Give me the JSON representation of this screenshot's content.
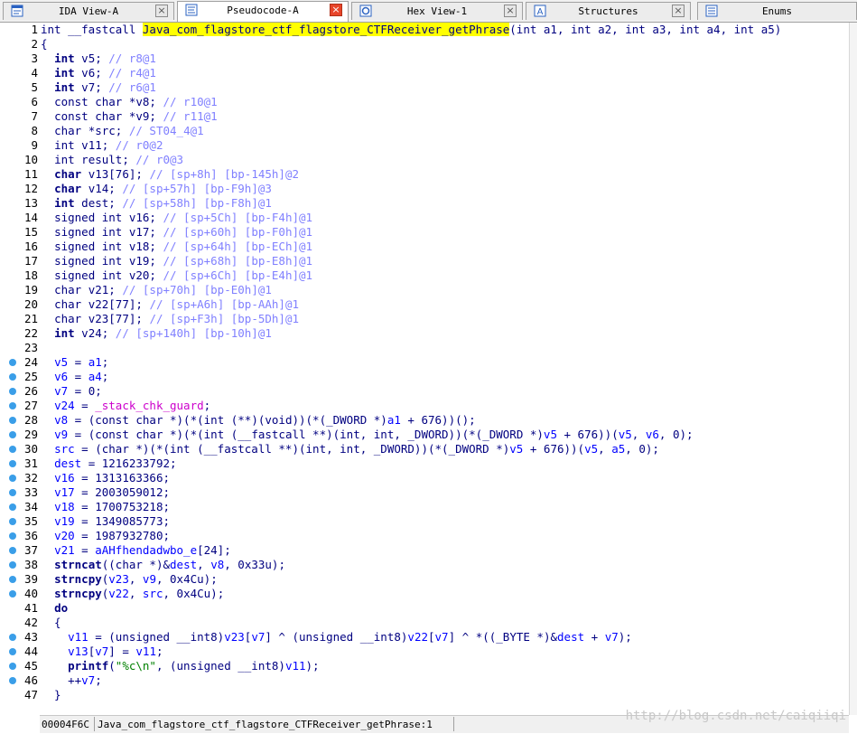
{
  "tabs": [
    {
      "label": "IDA View-A",
      "icon": "ida-view-icon",
      "active": false
    },
    {
      "label": "Pseudocode-A",
      "icon": "pseudocode-icon",
      "active": true
    },
    {
      "label": "Hex View-1",
      "icon": "hex-view-icon",
      "active": false
    },
    {
      "label": "Structures",
      "icon": "structures-icon",
      "active": false
    },
    {
      "label": "Enums",
      "icon": "enums-icon",
      "active": false
    }
  ],
  "lines": [
    {
      "n": "1",
      "bp": false,
      "parts": [
        [
          "type",
          "int __fastcall "
        ],
        [
          "hl",
          "Java_com_flagstore_ctf_flagstore_CTFReceiver_getPhrase"
        ],
        [
          "pl",
          "(int a1, int a2, int a3, int a4, int a5)"
        ]
      ]
    },
    {
      "n": "2",
      "bp": false,
      "parts": [
        [
          "pl",
          "{"
        ]
      ]
    },
    {
      "n": "3",
      "bp": false,
      "parts": [
        [
          "pl",
          "  "
        ],
        [
          "kw",
          "int"
        ],
        [
          "pl",
          " v5; "
        ],
        [
          "cmt",
          "// r8@1"
        ]
      ]
    },
    {
      "n": "4",
      "bp": false,
      "parts": [
        [
          "pl",
          "  "
        ],
        [
          "kw",
          "int"
        ],
        [
          "pl",
          " v6; "
        ],
        [
          "cmt",
          "// r4@1"
        ]
      ]
    },
    {
      "n": "5",
      "bp": false,
      "parts": [
        [
          "pl",
          "  "
        ],
        [
          "kw",
          "int"
        ],
        [
          "pl",
          " v7; "
        ],
        [
          "cmt",
          "// r6@1"
        ]
      ]
    },
    {
      "n": "6",
      "bp": false,
      "parts": [
        [
          "pl",
          "  "
        ],
        [
          "type",
          "const char"
        ],
        [
          "pl",
          " *v8; "
        ],
        [
          "cmt",
          "// r10@1"
        ]
      ]
    },
    {
      "n": "7",
      "bp": false,
      "parts": [
        [
          "pl",
          "  "
        ],
        [
          "type",
          "const char"
        ],
        [
          "pl",
          " *v9; "
        ],
        [
          "cmt",
          "// r11@1"
        ]
      ]
    },
    {
      "n": "8",
      "bp": false,
      "parts": [
        [
          "pl",
          "  "
        ],
        [
          "type",
          "char"
        ],
        [
          "pl",
          " *src; "
        ],
        [
          "cmt",
          "// ST04_4@1"
        ]
      ]
    },
    {
      "n": "9",
      "bp": false,
      "parts": [
        [
          "pl",
          "  "
        ],
        [
          "type",
          "int"
        ],
        [
          "pl",
          " v11; "
        ],
        [
          "cmt",
          "// r0@2"
        ]
      ]
    },
    {
      "n": "10",
      "bp": false,
      "parts": [
        [
          "pl",
          "  "
        ],
        [
          "type",
          "int"
        ],
        [
          "pl",
          " result; "
        ],
        [
          "cmt",
          "// r0@3"
        ]
      ]
    },
    {
      "n": "11",
      "bp": false,
      "parts": [
        [
          "pl",
          "  "
        ],
        [
          "kw",
          "char"
        ],
        [
          "pl",
          " v13[76]; "
        ],
        [
          "cmt",
          "// [sp+8h] [bp-145h]@2"
        ]
      ]
    },
    {
      "n": "12",
      "bp": false,
      "parts": [
        [
          "pl",
          "  "
        ],
        [
          "kw",
          "char"
        ],
        [
          "pl",
          " v14; "
        ],
        [
          "cmt",
          "// [sp+57h] [bp-F9h]@3"
        ]
      ]
    },
    {
      "n": "13",
      "bp": false,
      "parts": [
        [
          "pl",
          "  "
        ],
        [
          "kw",
          "int"
        ],
        [
          "pl",
          " dest; "
        ],
        [
          "cmt",
          "// [sp+58h] [bp-F8h]@1"
        ]
      ]
    },
    {
      "n": "14",
      "bp": false,
      "parts": [
        [
          "pl",
          "  "
        ],
        [
          "type",
          "signed int"
        ],
        [
          "pl",
          " v16; "
        ],
        [
          "cmt",
          "// [sp+5Ch] [bp-F4h]@1"
        ]
      ]
    },
    {
      "n": "15",
      "bp": false,
      "parts": [
        [
          "pl",
          "  "
        ],
        [
          "type",
          "signed int"
        ],
        [
          "pl",
          " v17; "
        ],
        [
          "cmt",
          "// [sp+60h] [bp-F0h]@1"
        ]
      ]
    },
    {
      "n": "16",
      "bp": false,
      "parts": [
        [
          "pl",
          "  "
        ],
        [
          "type",
          "signed int"
        ],
        [
          "pl",
          " v18; "
        ],
        [
          "cmt",
          "// [sp+64h] [bp-ECh]@1"
        ]
      ]
    },
    {
      "n": "17",
      "bp": false,
      "parts": [
        [
          "pl",
          "  "
        ],
        [
          "type",
          "signed int"
        ],
        [
          "pl",
          " v19; "
        ],
        [
          "cmt",
          "// [sp+68h] [bp-E8h]@1"
        ]
      ]
    },
    {
      "n": "18",
      "bp": false,
      "parts": [
        [
          "pl",
          "  "
        ],
        [
          "type",
          "signed int"
        ],
        [
          "pl",
          " v20; "
        ],
        [
          "cmt",
          "// [sp+6Ch] [bp-E4h]@1"
        ]
      ]
    },
    {
      "n": "19",
      "bp": false,
      "parts": [
        [
          "pl",
          "  "
        ],
        [
          "type",
          "char"
        ],
        [
          "pl",
          " v21; "
        ],
        [
          "cmt",
          "// [sp+70h] [bp-E0h]@1"
        ]
      ]
    },
    {
      "n": "20",
      "bp": false,
      "parts": [
        [
          "pl",
          "  "
        ],
        [
          "type",
          "char"
        ],
        [
          "pl",
          " v22[77]; "
        ],
        [
          "cmt",
          "// [sp+A6h] [bp-AAh]@1"
        ]
      ]
    },
    {
      "n": "21",
      "bp": false,
      "parts": [
        [
          "pl",
          "  "
        ],
        [
          "type",
          "char"
        ],
        [
          "pl",
          " v23[77]; "
        ],
        [
          "cmt",
          "// [sp+F3h] [bp-5Dh]@1"
        ]
      ]
    },
    {
      "n": "22",
      "bp": false,
      "parts": [
        [
          "pl",
          "  "
        ],
        [
          "kw",
          "int"
        ],
        [
          "pl",
          " v24; "
        ],
        [
          "cmt",
          "// [sp+140h] [bp-10h]@1"
        ]
      ]
    },
    {
      "n": "23",
      "bp": false,
      "parts": []
    },
    {
      "n": "24",
      "bp": true,
      "parts": [
        [
          "pl",
          "  "
        ],
        [
          "var",
          "v5"
        ],
        [
          "pl",
          " = "
        ],
        [
          "var",
          "a1"
        ],
        [
          "pl",
          ";"
        ]
      ]
    },
    {
      "n": "25",
      "bp": true,
      "parts": [
        [
          "pl",
          "  "
        ],
        [
          "var",
          "v6"
        ],
        [
          "pl",
          " = "
        ],
        [
          "var",
          "a4"
        ],
        [
          "pl",
          ";"
        ]
      ]
    },
    {
      "n": "26",
      "bp": true,
      "parts": [
        [
          "pl",
          "  "
        ],
        [
          "var",
          "v7"
        ],
        [
          "pl",
          " = 0;"
        ]
      ]
    },
    {
      "n": "27",
      "bp": true,
      "parts": [
        [
          "pl",
          "  "
        ],
        [
          "var",
          "v24"
        ],
        [
          "pl",
          " = "
        ],
        [
          "glob",
          "_stack_chk_guard"
        ],
        [
          "pl",
          ";"
        ]
      ]
    },
    {
      "n": "28",
      "bp": true,
      "parts": [
        [
          "pl",
          "  "
        ],
        [
          "var",
          "v8"
        ],
        [
          "pl",
          " = (const char *)(*(int (**)(void))(*(_DWORD *)"
        ],
        [
          "var",
          "a1"
        ],
        [
          "pl",
          " + 676))();"
        ]
      ]
    },
    {
      "n": "29",
      "bp": true,
      "parts": [
        [
          "pl",
          "  "
        ],
        [
          "var",
          "v9"
        ],
        [
          "pl",
          " = (const char *)(*(int (__fastcall **)(int, int, _DWORD))(*(_DWORD *)"
        ],
        [
          "var",
          "v5"
        ],
        [
          "pl",
          " + 676))("
        ],
        [
          "var",
          "v5"
        ],
        [
          "pl",
          ", "
        ],
        [
          "var",
          "v6"
        ],
        [
          "pl",
          ", 0);"
        ]
      ]
    },
    {
      "n": "30",
      "bp": true,
      "parts": [
        [
          "pl",
          "  "
        ],
        [
          "var",
          "src"
        ],
        [
          "pl",
          " = (char *)(*(int (__fastcall **)(int, int, _DWORD))(*(_DWORD *)"
        ],
        [
          "var",
          "v5"
        ],
        [
          "pl",
          " + 676))("
        ],
        [
          "var",
          "v5"
        ],
        [
          "pl",
          ", "
        ],
        [
          "var",
          "a5"
        ],
        [
          "pl",
          ", 0);"
        ]
      ]
    },
    {
      "n": "31",
      "bp": true,
      "parts": [
        [
          "pl",
          "  "
        ],
        [
          "var",
          "dest"
        ],
        [
          "pl",
          " = 1216233792;"
        ]
      ]
    },
    {
      "n": "32",
      "bp": true,
      "parts": [
        [
          "pl",
          "  "
        ],
        [
          "var",
          "v16"
        ],
        [
          "pl",
          " = 1313163366;"
        ]
      ]
    },
    {
      "n": "33",
      "bp": true,
      "parts": [
        [
          "pl",
          "  "
        ],
        [
          "var",
          "v17"
        ],
        [
          "pl",
          " = 2003059012;"
        ]
      ]
    },
    {
      "n": "34",
      "bp": true,
      "parts": [
        [
          "pl",
          "  "
        ],
        [
          "var",
          "v18"
        ],
        [
          "pl",
          " = 1700753218;"
        ]
      ]
    },
    {
      "n": "35",
      "bp": true,
      "parts": [
        [
          "pl",
          "  "
        ],
        [
          "var",
          "v19"
        ],
        [
          "pl",
          " = 1349085773;"
        ]
      ]
    },
    {
      "n": "36",
      "bp": true,
      "parts": [
        [
          "pl",
          "  "
        ],
        [
          "var",
          "v20"
        ],
        [
          "pl",
          " = 1987932780;"
        ]
      ]
    },
    {
      "n": "37",
      "bp": true,
      "parts": [
        [
          "pl",
          "  "
        ],
        [
          "var",
          "v21"
        ],
        [
          "pl",
          " = "
        ],
        [
          "var",
          "aAHfhendadwbo_e"
        ],
        [
          "pl",
          "[24];"
        ]
      ]
    },
    {
      "n": "38",
      "bp": true,
      "parts": [
        [
          "pl",
          "  "
        ],
        [
          "kw",
          "strncat"
        ],
        [
          "pl",
          "((char *)&"
        ],
        [
          "var",
          "dest"
        ],
        [
          "pl",
          ", "
        ],
        [
          "var",
          "v8"
        ],
        [
          "pl",
          ", 0x33u);"
        ]
      ]
    },
    {
      "n": "39",
      "bp": true,
      "parts": [
        [
          "pl",
          "  "
        ],
        [
          "kw",
          "strncpy"
        ],
        [
          "pl",
          "("
        ],
        [
          "var",
          "v23"
        ],
        [
          "pl",
          ", "
        ],
        [
          "var",
          "v9"
        ],
        [
          "pl",
          ", 0x4Cu);"
        ]
      ]
    },
    {
      "n": "40",
      "bp": true,
      "parts": [
        [
          "pl",
          "  "
        ],
        [
          "kw",
          "strncpy"
        ],
        [
          "pl",
          "("
        ],
        [
          "var",
          "v22"
        ],
        [
          "pl",
          ", "
        ],
        [
          "var",
          "src"
        ],
        [
          "pl",
          ", 0x4Cu);"
        ]
      ]
    },
    {
      "n": "41",
      "bp": false,
      "parts": [
        [
          "pl",
          "  "
        ],
        [
          "kw",
          "do"
        ]
      ]
    },
    {
      "n": "42",
      "bp": false,
      "parts": [
        [
          "pl",
          "  {"
        ]
      ]
    },
    {
      "n": "43",
      "bp": true,
      "parts": [
        [
          "pl",
          "    "
        ],
        [
          "var",
          "v11"
        ],
        [
          "pl",
          " = (unsigned __int8)"
        ],
        [
          "var",
          "v23"
        ],
        [
          "pl",
          "["
        ],
        [
          "var",
          "v7"
        ],
        [
          "pl",
          "] ^ (unsigned __int8)"
        ],
        [
          "var",
          "v22"
        ],
        [
          "pl",
          "["
        ],
        [
          "var",
          "v7"
        ],
        [
          "pl",
          "] ^ *((_BYTE *)&"
        ],
        [
          "var",
          "dest"
        ],
        [
          "pl",
          " + "
        ],
        [
          "var",
          "v7"
        ],
        [
          "pl",
          ");"
        ]
      ]
    },
    {
      "n": "44",
      "bp": true,
      "parts": [
        [
          "pl",
          "    "
        ],
        [
          "var",
          "v13"
        ],
        [
          "pl",
          "["
        ],
        [
          "var",
          "v7"
        ],
        [
          "pl",
          "] = "
        ],
        [
          "var",
          "v11"
        ],
        [
          "pl",
          ";"
        ]
      ]
    },
    {
      "n": "45",
      "bp": true,
      "parts": [
        [
          "pl",
          "    "
        ],
        [
          "kw",
          "printf"
        ],
        [
          "pl",
          "("
        ],
        [
          "str",
          "\"%c\\n\""
        ],
        [
          "pl",
          ", (unsigned __int8)"
        ],
        [
          "var",
          "v11"
        ],
        [
          "pl",
          ");"
        ]
      ]
    },
    {
      "n": "46",
      "bp": true,
      "parts": [
        [
          "pl",
          "    ++"
        ],
        [
          "var",
          "v7"
        ],
        [
          "pl",
          ";"
        ]
      ]
    },
    {
      "n": "47",
      "bp": false,
      "parts": [
        [
          "pl",
          "  }"
        ]
      ]
    }
  ],
  "status": {
    "address": "00004F6C",
    "function": "Java_com_flagstore_ctf_flagstore_CTFReceiver_getPhrase:1"
  },
  "watermark": "http://blog.csdn.net/caiqiiqi",
  "colors": {
    "highlight": "#ffff00",
    "comment": "#8080ff",
    "variable": "#0000ff",
    "global": "#cc00cc",
    "breakpoint": "#3a9ee8",
    "active_tab_close": "#e8452a"
  }
}
